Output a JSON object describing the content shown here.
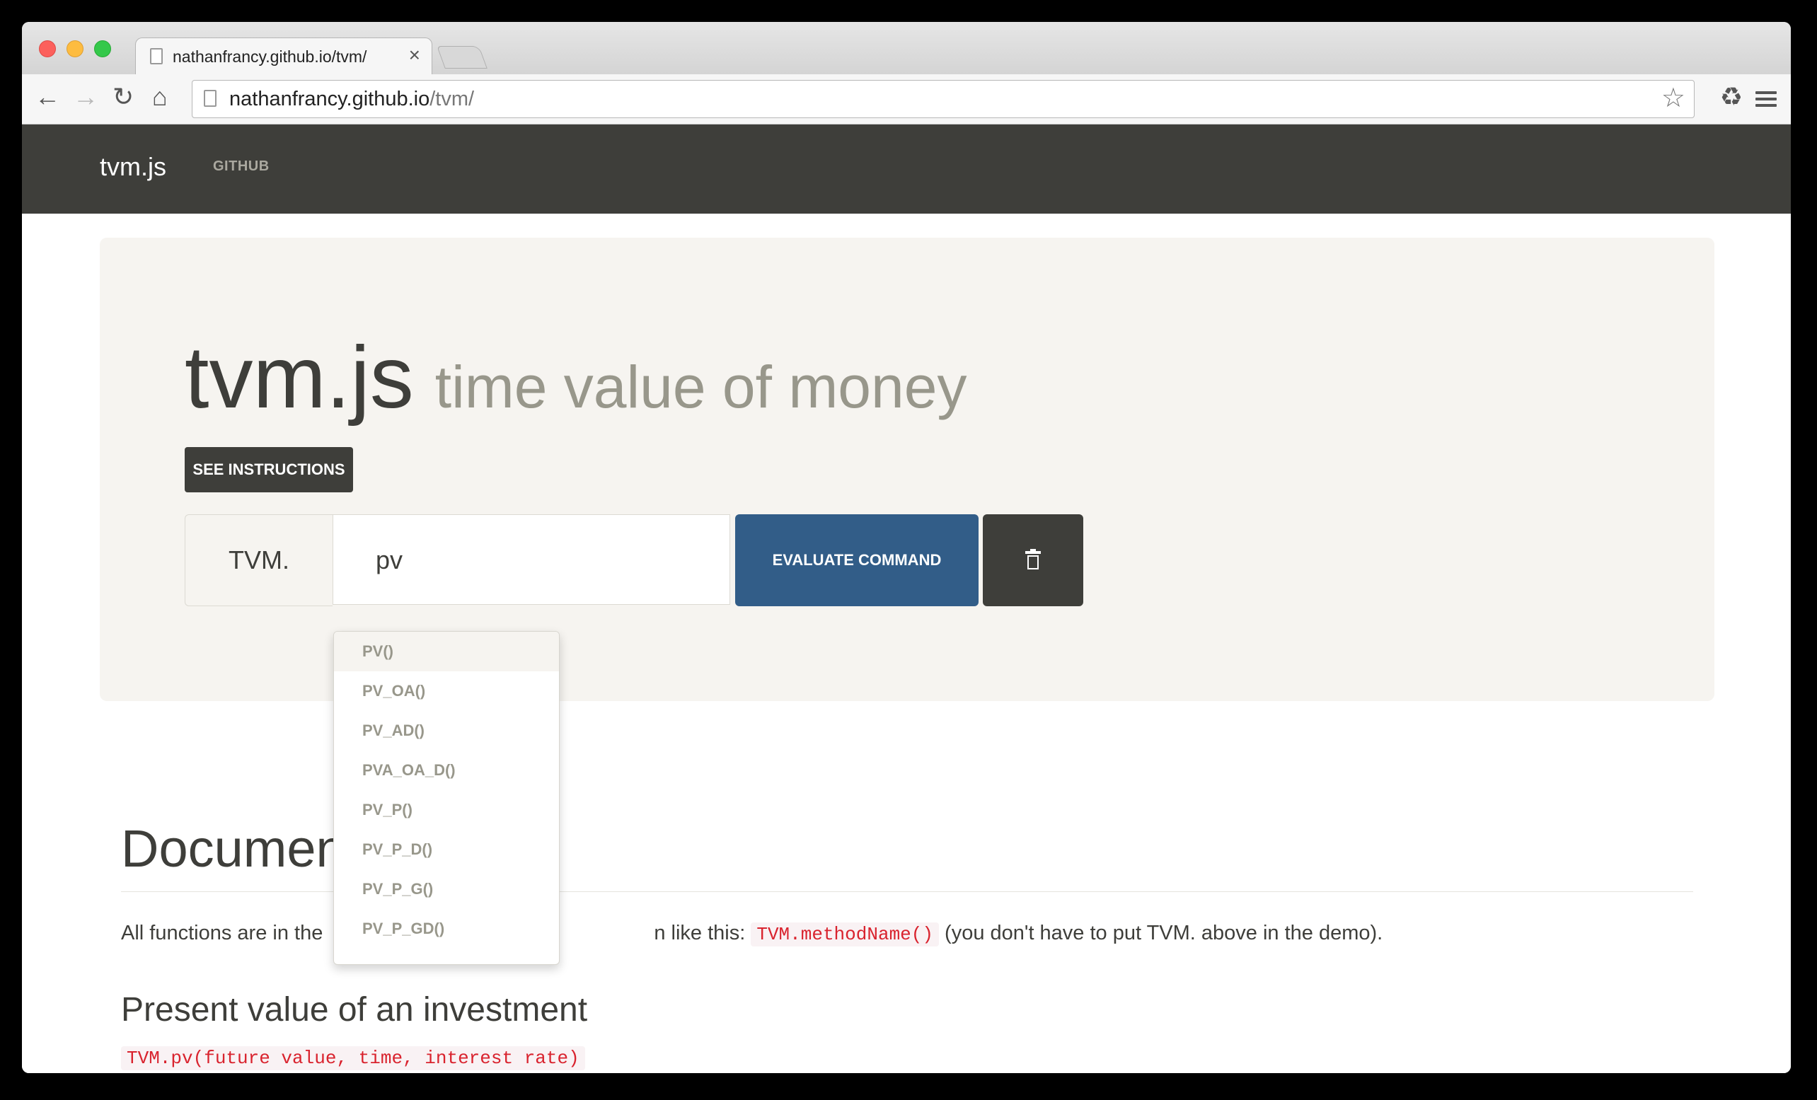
{
  "browser": {
    "tab_title": "nathanfrancy.github.io/tvm/",
    "tab_close": "×",
    "url_host": "nathanfrancy.github.io",
    "url_path": "/tvm/",
    "icons": [
      "back-arrow-icon",
      "forward-arrow-icon",
      "reload-icon",
      "home-icon",
      "page-icon",
      "star-icon",
      "recycle-icon",
      "menu-icon"
    ]
  },
  "navbar": {
    "brand": "tvm.js",
    "github_link": "GITHUB"
  },
  "jumbotron": {
    "title": "tvm.js",
    "subtitle": "time value of money",
    "instructions_button": "SEE INSTRUCTIONS",
    "input_prefix": "TVM.",
    "input_value": "pv",
    "evaluate_button": "EVALUATE COMMAND",
    "clear_icon": "trash-icon"
  },
  "autocomplete": {
    "items": [
      "PV()",
      "PV_OA()",
      "PV_AD()",
      "PVA_OA_D()",
      "PV_P()",
      "PV_P_D()",
      "PV_P_G()",
      "PV_P_GD()"
    ],
    "active_index": 0
  },
  "documentation": {
    "heading": "Documen",
    "intro_before": "All functions are in the",
    "intro_mid": "n like this:",
    "intro_code": "TVM.methodName()",
    "intro_after": "(you don't have to put TVM. above in the demo).",
    "section_title": "Present value of an investment",
    "section_code": "TVM.pv(future value, time, interest rate)"
  },
  "colors": {
    "navbar_bg": "#3e3e3a",
    "jumbotron_bg": "#f6f4f0",
    "primary": "#325d88",
    "code_text": "#d9232e",
    "muted_text": "#98978b"
  }
}
